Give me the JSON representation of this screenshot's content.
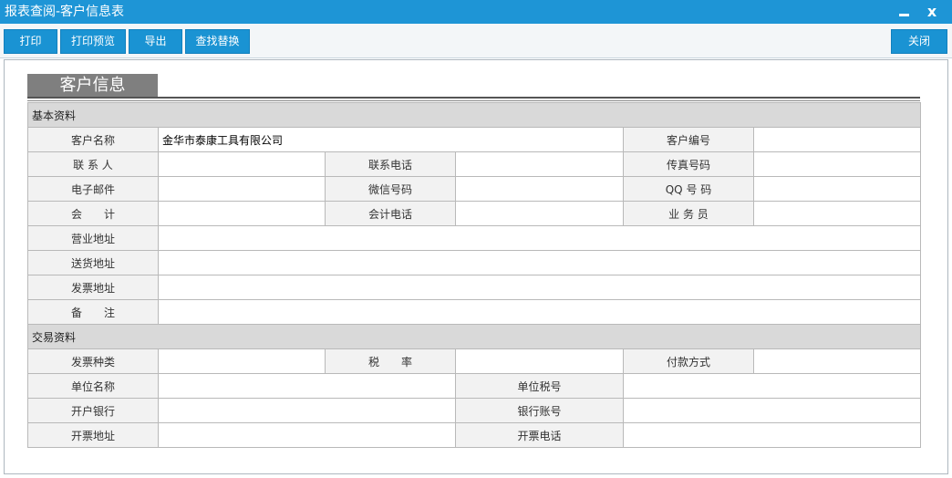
{
  "window": {
    "title": "报表查阅-客户信息表",
    "minimize_icon": "minimize-icon",
    "close_glyph": "x"
  },
  "toolbar": {
    "print": "打印",
    "print_preview": "打印预览",
    "export": "导出",
    "find_replace": "查找替换",
    "close": "关闭"
  },
  "section": {
    "title": "客户信息"
  },
  "basic": {
    "group_label": "基本资料",
    "customer_name_label": "客户名称",
    "customer_name_value": "金华市泰康工具有限公司",
    "customer_no_label": "客户编号",
    "customer_no_value": "",
    "contact_label": "联 系 人",
    "contact_value": "",
    "phone_label": "联系电话",
    "phone_value": "",
    "fax_label": "传真号码",
    "fax_value": "",
    "email_label": "电子邮件",
    "email_value": "",
    "wechat_label": "微信号码",
    "wechat_value": "",
    "qq_label": "QQ 号 码",
    "qq_value": "",
    "accountant_label": "会　　计",
    "accountant_value": "",
    "accountant_phone_label": "会计电话",
    "accountant_phone_value": "",
    "salesman_label": "业 务 员",
    "salesman_value": "",
    "business_address_label": "营业地址",
    "business_address_value": "",
    "delivery_address_label": "送货地址",
    "delivery_address_value": "",
    "invoice_address_label": "发票地址",
    "invoice_address_value": "",
    "remark_label": "备　　注",
    "remark_value": ""
  },
  "trade": {
    "group_label": "交易资料",
    "invoice_type_label": "发票种类",
    "invoice_type_value": "",
    "tax_rate_label": "税　　率",
    "tax_rate_value": "",
    "payment_label": "付款方式",
    "payment_value": "",
    "unit_name_label": "单位名称",
    "unit_name_value": "",
    "tax_no_label": "单位税号",
    "tax_no_value": "",
    "bank_label": "开户银行",
    "bank_value": "",
    "account_label": "银行账号",
    "account_value": "",
    "billing_address_label": "开票地址",
    "billing_address_value": "",
    "billing_phone_label": "开票电话",
    "billing_phone_value": ""
  }
}
